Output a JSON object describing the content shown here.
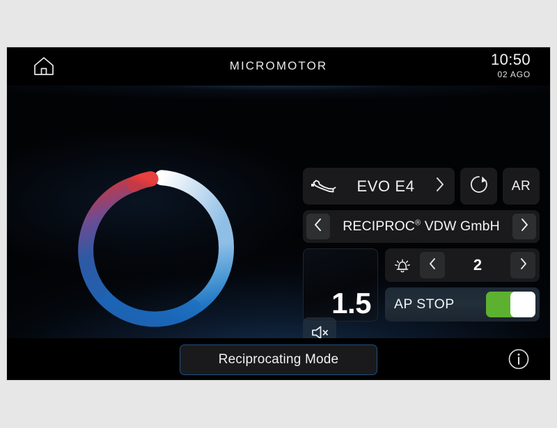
{
  "device": {
    "header": {
      "home_icon": "home-icon",
      "title": "MICROMOTOR",
      "time": "10:50",
      "date": "02 AGO"
    },
    "gauge": {
      "icon": "speed-ring-gauge",
      "gap_degrees": 18,
      "stops": [
        {
          "pos": 0.0,
          "color": "#ffffff"
        },
        {
          "pos": 0.1,
          "color": "#e8eff7"
        },
        {
          "pos": 0.26,
          "color": "#a9cbe9"
        },
        {
          "pos": 0.45,
          "color": "#72b0e0"
        },
        {
          "pos": 0.62,
          "color": "#2a7fc9"
        },
        {
          "pos": 0.74,
          "color": "#1b69ba"
        },
        {
          "pos": 0.86,
          "color": "#3a5fa8"
        },
        {
          "pos": 0.93,
          "color": "#8a4a80"
        },
        {
          "pos": 0.975,
          "color": "#d13a3f"
        },
        {
          "pos": 1.0,
          "color": "#e03a3a"
        }
      ]
    },
    "controls": {
      "handpiece": {
        "icon": "handpiece-icon",
        "label": "EVO E4",
        "next_icon": "chevron-right-icon"
      },
      "rotation_button": {
        "icon": "rotation-clockwise-icon",
        "label": ""
      },
      "ar_button": {
        "label": "AR"
      },
      "file_system": {
        "prev_icon": "chevron-left-icon",
        "label": "RECIPROC",
        "label_sup": "®",
        "label_rest": " VDW GmbH",
        "next_icon": "chevron-right-icon"
      },
      "torque": {
        "value": "1.5"
      },
      "alarm": {
        "icon": "alarm-bell-icon",
        "prev_icon": "chevron-left-icon",
        "value": "2",
        "next_icon": "chevron-right-icon"
      },
      "ap_stop": {
        "label": "AP STOP",
        "toggle_state": "on",
        "toggle_on_color": "#5cb130",
        "knob_color": "#ffffff"
      },
      "mute": {
        "icon": "speaker-mute-icon"
      }
    },
    "footer": {
      "mode_button": {
        "label": "Reciprocating Mode",
        "border_color": "#1f4f86"
      },
      "info_button": {
        "icon": "info-circle-icon"
      }
    }
  }
}
